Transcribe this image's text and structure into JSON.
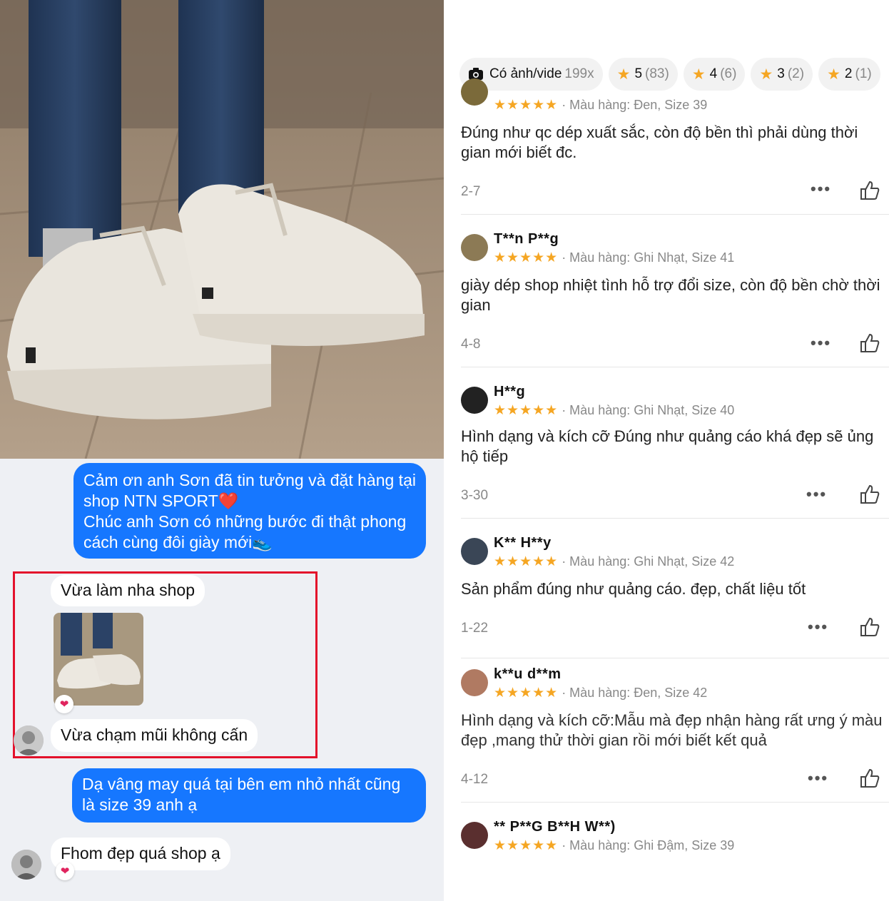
{
  "chat": {
    "msg1": "Cảm ơn anh Sơn đã tin tưởng và đặt hàng tại shop NTN SPORT❤️",
    "msg1b": "Chúc anh Sơn có những bước đi thật phong cách cùng đôi giày mới👟",
    "msg2": "Vừa làm nha shop",
    "msg3": "Vừa chạm mũi không cấn",
    "msg4": "Dạ vâng may quá tại bên em nhỏ nhất cũng là size 39 anh ạ",
    "msg5": "Fhom đẹp quá shop ạ",
    "reaction": "❤"
  },
  "filters": [
    {
      "label": "Có ảnh/vide",
      "count": "199x",
      "icon": "camera-icon"
    },
    {
      "label": "5",
      "count": "(83)",
      "icon": "star-icon"
    },
    {
      "label": "4",
      "count": "(6)",
      "icon": "star-icon"
    },
    {
      "label": "3",
      "count": "(2)",
      "icon": "star-icon"
    },
    {
      "label": "2",
      "count": "(1)",
      "icon": "star-icon"
    }
  ],
  "reviews": [
    {
      "name": "",
      "stars": "★★★★★",
      "meta": "· Màu hàng: Đen, Size 39",
      "text": "Đúng như qc dép xuất sắc, còn độ bền thì phải dùng thời gian mới biết đc.",
      "date": "2-7"
    },
    {
      "name": "T**n P**g",
      "stars": "★★★★★",
      "meta": "· Màu hàng: Ghi Nhạt, Size 41",
      "text": "giày dép shop nhiệt tình hỗ trợ đổi size, còn độ bền chờ thời gian",
      "date": "4-8"
    },
    {
      "name": "H**g",
      "stars": "★★★★★",
      "meta": "· Màu hàng: Ghi Nhạt, Size 40",
      "text": "Hình dạng và kích cỡ Đúng như quảng cáo khá đẹp sẽ ủng hộ tiếp",
      "date": "3-30"
    },
    {
      "name": "K** H**y",
      "stars": "★★★★★",
      "meta": "· Màu hàng: Ghi Nhạt, Size 42",
      "text": "Sản phẩm đúng như quảng cáo. đẹp, chất liệu tốt",
      "date": "1-22"
    },
    {
      "name": "k**u d**m",
      "stars": "★★★★★",
      "meta": "· Màu hàng: Đen, Size 42",
      "text": "Hình dạng và kích cỡ:Mẫu mà đẹp nhận hàng rất ưng ý màu đẹp ,mang thử thời gian rồi mới biết kết quả",
      "date": "4-12"
    },
    {
      "name": "** P**G B**H W**)",
      "stars": "★★★★★",
      "meta": "· Màu hàng: Ghi Đậm, Size 39",
      "text": "",
      "date": ""
    }
  ],
  "colors": {
    "accent": "#1677ff",
    "star": "#f5a623",
    "highlight": "#e3112b"
  }
}
